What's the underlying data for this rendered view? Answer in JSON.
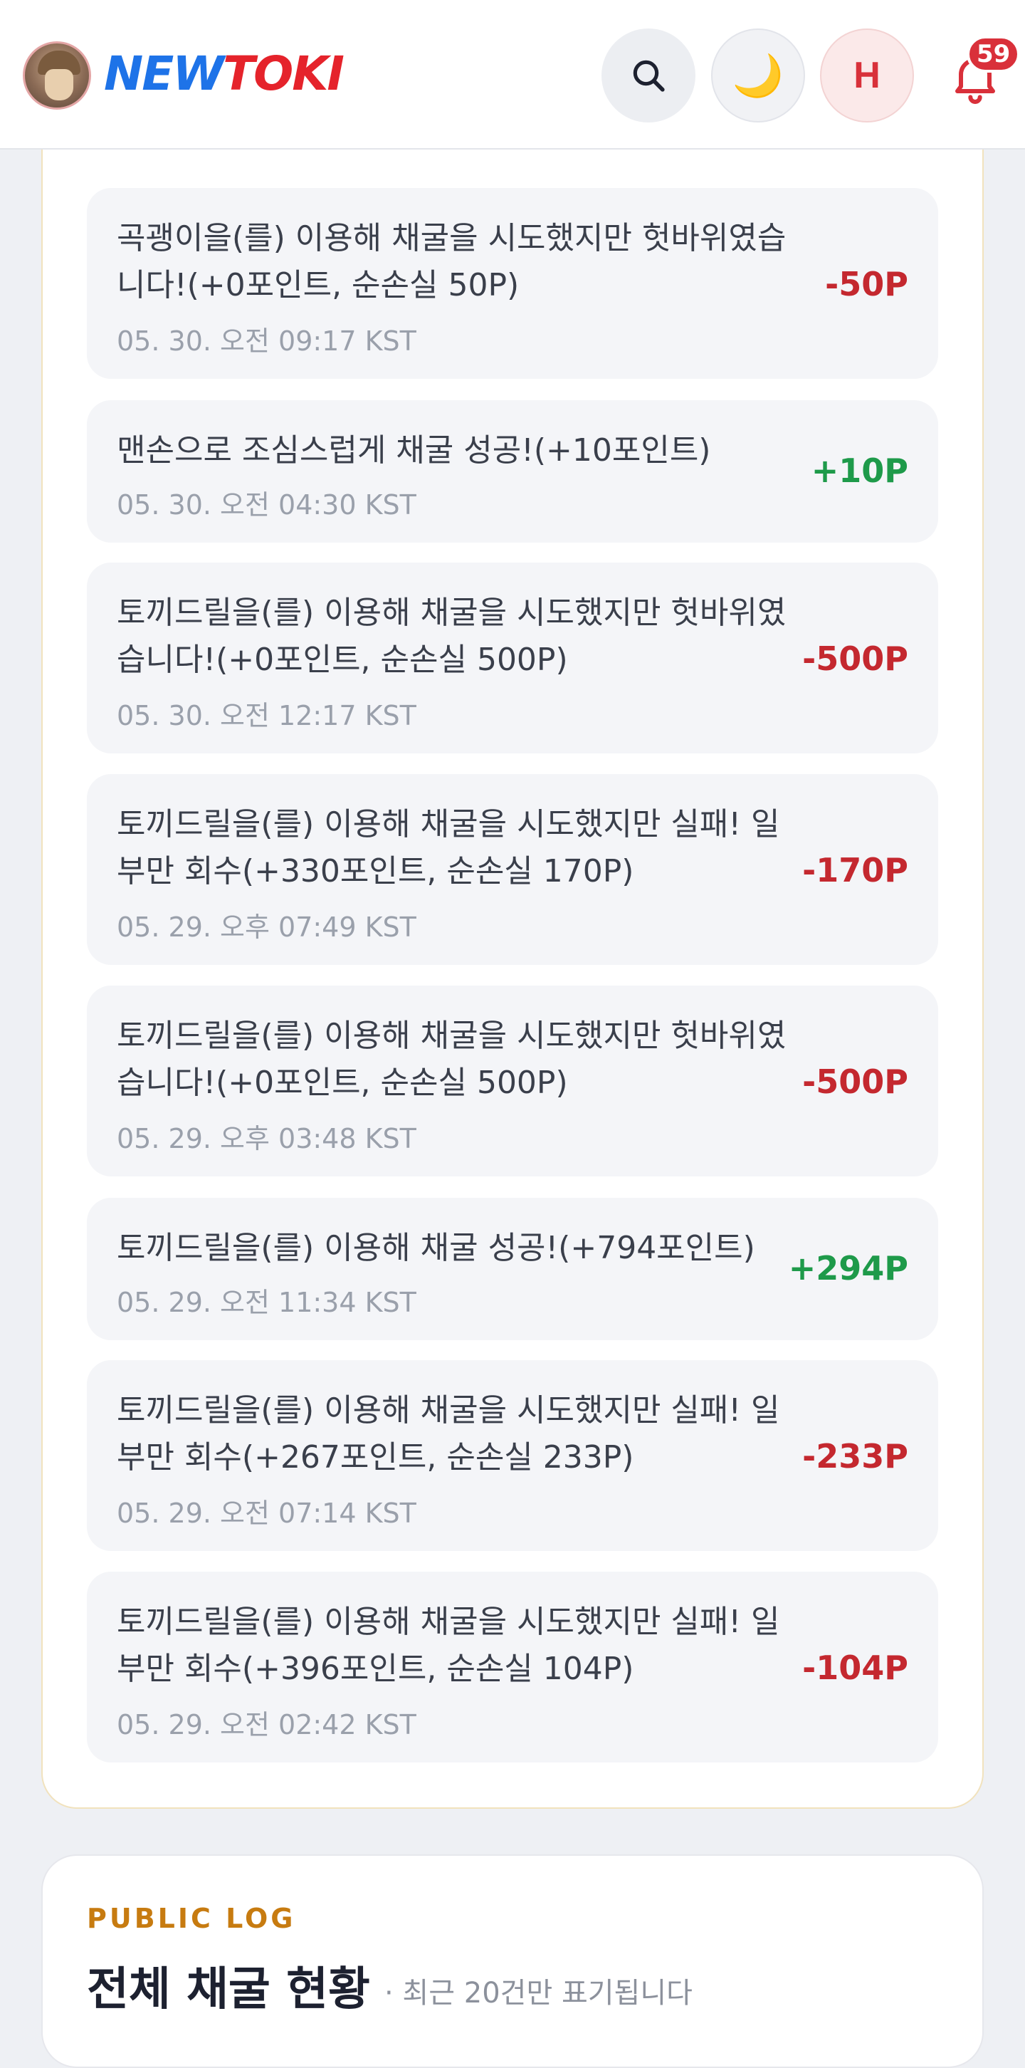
{
  "header": {
    "logo_new": "NEW",
    "logo_toki": "TOKI",
    "user_initial": "H",
    "notification_count": "59",
    "icons": [
      "search-icon",
      "moon-icon",
      "bell-icon"
    ],
    "accent_blue": "#1e73e8",
    "accent_red": "#e5232b"
  },
  "log_items": [
    {
      "text": "곡괭이을(를) 이용해 채굴을 시도했지만 헛바위였습니다!(+0포인트, 순손실 50P)",
      "time": "05. 30. 오전 09:17 KST",
      "amount": "-50P",
      "type": "neg"
    },
    {
      "text": "맨손으로 조심스럽게 채굴 성공!(+10포인트)",
      "time": "05. 30. 오전 04:30 KST",
      "amount": "+10P",
      "type": "pos"
    },
    {
      "text": "토끼드릴을(를) 이용해 채굴을 시도했지만 헛바위였습니다!(+0포인트, 순손실 500P)",
      "time": "05. 30. 오전 12:17 KST",
      "amount": "-500P",
      "type": "neg"
    },
    {
      "text": "토끼드릴을(를) 이용해 채굴을 시도했지만 실패! 일부만 회수(+330포인트, 순손실 170P)",
      "time": "05. 29. 오후 07:49 KST",
      "amount": "-170P",
      "type": "neg"
    },
    {
      "text": "토끼드릴을(를) 이용해 채굴을 시도했지만 헛바위였습니다!(+0포인트, 순손실 500P)",
      "time": "05. 29. 오후 03:48 KST",
      "amount": "-500P",
      "type": "neg"
    },
    {
      "text": "토끼드릴을(를) 이용해 채굴 성공!(+794포인트)",
      "time": "05. 29. 오전 11:34 KST",
      "amount": "+294P",
      "type": "pos"
    },
    {
      "text": "토끼드릴을(를) 이용해 채굴을 시도했지만 실패! 일부만 회수(+267포인트, 순손실 233P)",
      "time": "05. 29. 오전 07:14 KST",
      "amount": "-233P",
      "type": "neg"
    },
    {
      "text": "토끼드릴을(를) 이용해 채굴을 시도했지만 실패! 일부만 회수(+396포인트, 순손실 104P)",
      "time": "05. 29. 오전 02:42 KST",
      "amount": "-104P",
      "type": "neg"
    }
  ],
  "public_log": {
    "kicker": "PUBLIC LOG",
    "title": "전체 채굴 현황",
    "subtitle": "· 최근 20건만 표기됩니다"
  },
  "colors": {
    "negative": "#c4282f",
    "positive": "#1e9a4a",
    "kicker": "#c77b10"
  }
}
